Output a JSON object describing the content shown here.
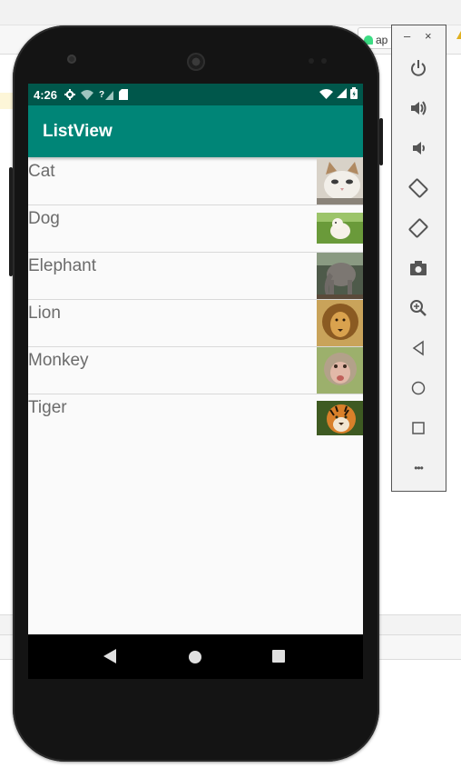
{
  "ide": {
    "tab_label": "ap"
  },
  "emulator_panel": {
    "minimize": "–",
    "close": "×",
    "more": "•••",
    "buttons": [
      "power-icon",
      "volume-up-icon",
      "volume-down-icon",
      "rotate-left-icon",
      "rotate-right-icon",
      "camera-icon",
      "zoom-icon",
      "back-icon",
      "home-icon",
      "overview-icon",
      "more-icon"
    ]
  },
  "status_bar": {
    "time": "4:26",
    "sim_label": "?"
  },
  "app_bar": {
    "title": "ListView",
    "color": "#008577",
    "status_color": "#00574b"
  },
  "list": {
    "items": [
      {
        "label": "Cat",
        "image": "cat-photo"
      },
      {
        "label": "Dog",
        "image": "dog-photo"
      },
      {
        "label": "Elephant",
        "image": "elephant-photo"
      },
      {
        "label": "Lion",
        "image": "lion-photo"
      },
      {
        "label": "Monkey",
        "image": "monkey-photo"
      },
      {
        "label": "Tiger",
        "image": "tiger-photo"
      }
    ]
  }
}
